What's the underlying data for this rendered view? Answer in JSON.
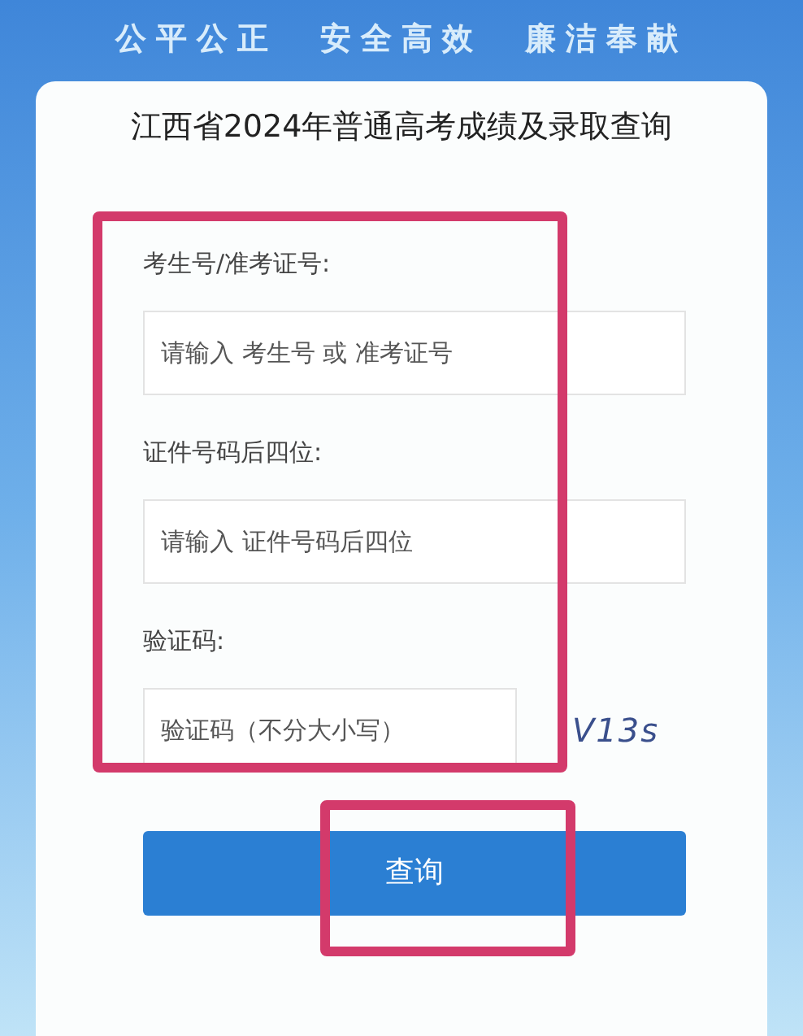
{
  "banner": {
    "slogans": [
      "公平公正",
      "安全高效",
      "廉洁奉献"
    ]
  },
  "card": {
    "title": "江西省2024年普通高考成绩及录取查询"
  },
  "fields": [
    {
      "label": "考生号/准考证号:",
      "placeholder": "请输入 考生号 或 准考证号",
      "kind": "text"
    },
    {
      "label": "证件号码后四位:",
      "placeholder": "请输入 证件号码后四位",
      "kind": "text"
    },
    {
      "label": "验证码:",
      "placeholder": "验证码（不分大小写）",
      "kind": "captcha",
      "captcha": "V13s"
    }
  ],
  "submit": {
    "label": "查询"
  }
}
